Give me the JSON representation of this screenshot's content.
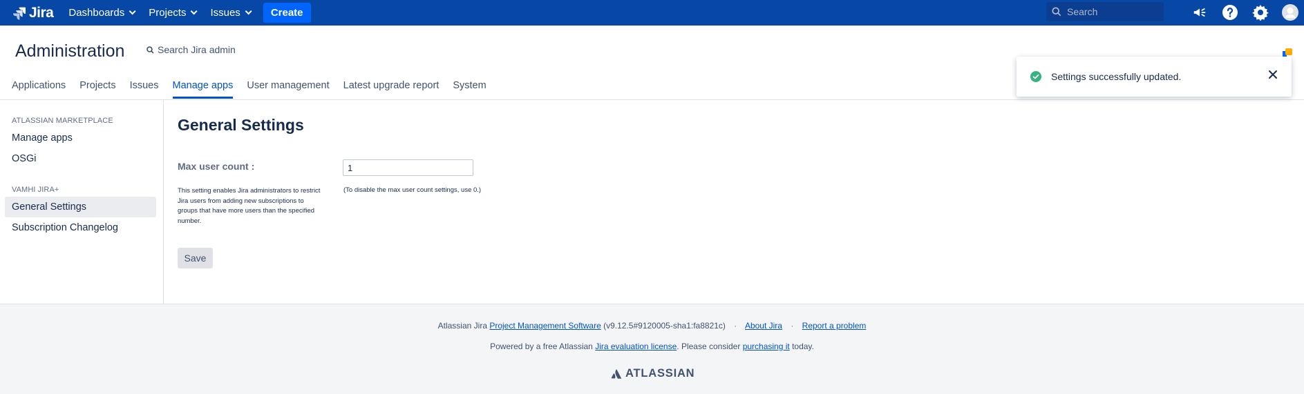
{
  "topnav": {
    "logo_text": "Jira",
    "items": [
      {
        "label": "Dashboards"
      },
      {
        "label": "Projects"
      },
      {
        "label": "Issues"
      }
    ],
    "create_label": "Create",
    "search_placeholder": "Search",
    "icons": [
      "megaphone-icon",
      "help-icon",
      "settings-icon",
      "avatar"
    ]
  },
  "admin": {
    "title": "Administration",
    "search_label": "Search Jira admin",
    "tabs": [
      {
        "label": "Applications"
      },
      {
        "label": "Projects"
      },
      {
        "label": "Issues"
      },
      {
        "label": "Manage apps",
        "active": true
      },
      {
        "label": "User management"
      },
      {
        "label": "Latest upgrade report"
      },
      {
        "label": "System"
      }
    ]
  },
  "toast": {
    "message": "Settings successfully updated."
  },
  "sidebar": {
    "sections": [
      {
        "heading": "ATLASSIAN MARKETPLACE",
        "items": [
          {
            "label": "Manage apps"
          },
          {
            "label": "OSGi"
          }
        ]
      },
      {
        "heading": "VAMHI JIRA+",
        "items": [
          {
            "label": "General Settings",
            "active": true
          },
          {
            "label": "Subscription Changelog"
          }
        ]
      }
    ]
  },
  "main": {
    "title": "General Settings",
    "field_label": "Max user count :",
    "field_description": "This setting enables Jira administrators to restrict Jira users from adding new subscriptions to groups that have more users than the specified number.",
    "field_value": "1",
    "field_hint": "(To disable the max user count settings, use 0.)",
    "save_label": "Save"
  },
  "footer": {
    "prefix": "Atlassian Jira",
    "pms_link": "Project Management Software",
    "version": "(v9.12.5#9120005-sha1:fa8821c)",
    "about_link": "About Jira",
    "report_link": "Report a problem",
    "powered_prefix": "Powered by a free Atlassian",
    "eval_link": "Jira evaluation license",
    "powered_mid": ". Please consider",
    "purchase_link": "purchasing it",
    "powered_suffix": "today.",
    "brand": "ATLASSIAN"
  },
  "colors": {
    "topbar": "#0747a6",
    "accent": "#0052cc",
    "success": "#36b37e"
  }
}
